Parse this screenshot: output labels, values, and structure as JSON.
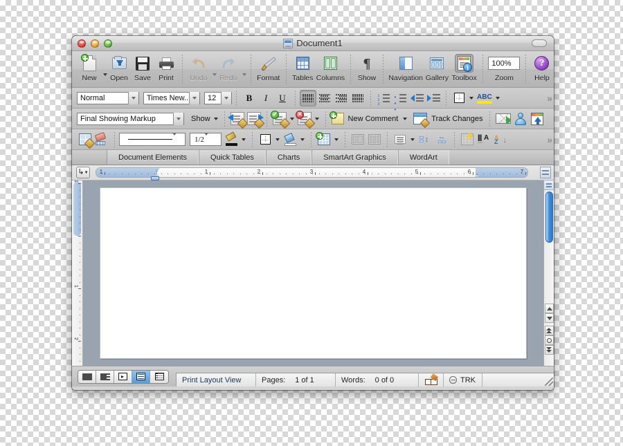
{
  "window": {
    "title": "Document1",
    "title_icon": "docx-file-icon",
    "controls": {
      "close": "close",
      "minimize": "minimize",
      "zoom": "zoom"
    },
    "toolbar_toggle": "toolbar-toggle-button"
  },
  "standard_toolbar": {
    "items": [
      {
        "label": "New",
        "icon": "new-document-icon",
        "dropdown": true,
        "disabled": false,
        "selected": false
      },
      {
        "label": "Open",
        "icon": "open-folder-icon",
        "dropdown": false,
        "disabled": false,
        "selected": false
      },
      {
        "label": "Save",
        "icon": "floppy-disk-icon",
        "dropdown": false,
        "disabled": false,
        "selected": false
      },
      {
        "label": "Print",
        "icon": "printer-icon",
        "dropdown": false,
        "disabled": false,
        "selected": false
      },
      {
        "label": "Undo",
        "icon": "undo-arrow-icon",
        "dropdown": true,
        "disabled": true,
        "selected": false
      },
      {
        "label": "Redo",
        "icon": "redo-arrow-icon",
        "dropdown": true,
        "disabled": true,
        "selected": false
      },
      {
        "label": "Format",
        "icon": "paintbrush-icon",
        "dropdown": false,
        "disabled": false,
        "selected": false
      },
      {
        "label": "Tables",
        "icon": "table-grid-icon",
        "dropdown": false,
        "disabled": false,
        "selected": false
      },
      {
        "label": "Columns",
        "icon": "columns-icon",
        "dropdown": false,
        "disabled": false,
        "selected": false
      },
      {
        "label": "Show",
        "icon": "pilcrow-icon",
        "dropdown": false,
        "disabled": false,
        "selected": false
      },
      {
        "label": "Navigation",
        "icon": "navigation-pane-icon",
        "dropdown": false,
        "disabled": false,
        "selected": false
      },
      {
        "label": "Gallery",
        "icon": "gallery-icon",
        "dropdown": false,
        "disabled": false,
        "selected": false
      },
      {
        "label": "Toolbox",
        "icon": "toolbox-icon",
        "dropdown": false,
        "disabled": false,
        "selected": true
      },
      {
        "label": "Zoom",
        "icon": "zoom-combo",
        "dropdown": true,
        "disabled": false,
        "selected": false
      },
      {
        "label": "Help",
        "icon": "help-question-icon",
        "dropdown": false,
        "disabled": false,
        "selected": false
      }
    ],
    "zoom_value": "100%"
  },
  "formatting_toolbar": {
    "style": {
      "value": "Normal",
      "name": "style-combo"
    },
    "font": {
      "value": "Times New...",
      "name": "font-combo"
    },
    "size": {
      "value": "12",
      "name": "font-size-combo"
    },
    "bold": "B",
    "italic": "I",
    "underline": "U",
    "buttons": [
      {
        "name": "align-left-button",
        "icon": "align-left-icon",
        "active": true
      },
      {
        "name": "align-center-button",
        "icon": "align-center-icon",
        "active": false
      },
      {
        "name": "align-right-button",
        "icon": "align-right-icon",
        "active": false
      },
      {
        "name": "align-justify-button",
        "icon": "align-justify-icon",
        "active": false
      },
      {
        "name": "numbered-list-button",
        "icon": "numbered-list-icon",
        "active": false
      },
      {
        "name": "bulleted-list-button",
        "icon": "bulleted-list-icon",
        "active": false
      },
      {
        "name": "decrease-indent-button",
        "icon": "decrease-indent-icon",
        "active": false
      },
      {
        "name": "increase-indent-button",
        "icon": "increase-indent-icon",
        "active": false
      },
      {
        "name": "borders-button",
        "icon": "borders-icon",
        "active": false
      },
      {
        "name": "highlight-button",
        "icon": "highlight-abc-icon",
        "active": false
      }
    ],
    "overflow": "»"
  },
  "reviewing_toolbar": {
    "display_mode": {
      "value": "Final Showing Markup",
      "name": "markup-display-combo"
    },
    "show_label": "Show",
    "new_comment_label": "New Comment",
    "track_changes_label": "Track Changes",
    "buttons": [
      {
        "name": "previous-change-button",
        "icon": "previous-change-icon"
      },
      {
        "name": "next-change-button",
        "icon": "next-change-icon"
      },
      {
        "name": "accept-change-button",
        "icon": "accept-change-icon"
      },
      {
        "name": "reject-change-button",
        "icon": "reject-change-icon"
      },
      {
        "name": "new-comment-button",
        "icon": "sticky-note-icon"
      },
      {
        "name": "track-changes-button",
        "icon": "track-changes-icon"
      },
      {
        "name": "mail-recipient-button",
        "icon": "send-mail-icon"
      },
      {
        "name": "reviewers-button",
        "icon": "person-icon"
      },
      {
        "name": "share-workbook-button",
        "icon": "share-upload-icon"
      }
    ]
  },
  "tables_toolbar": {
    "line_style": {
      "value": "",
      "name": "line-style-combo"
    },
    "line_weight": {
      "value": "1/2",
      "name": "line-weight-combo"
    },
    "buttons": [
      {
        "name": "draw-table-button",
        "icon": "draw-table-icon"
      },
      {
        "name": "eraser-button",
        "icon": "eraser-icon"
      },
      {
        "name": "border-color-button",
        "icon": "pen-color-icon"
      },
      {
        "name": "borders-button",
        "icon": "borders-icon"
      },
      {
        "name": "shading-color-button",
        "icon": "fill-bucket-icon"
      },
      {
        "name": "insert-table-button",
        "icon": "insert-table-icon"
      },
      {
        "name": "merge-cells-button",
        "icon": "merge-cells-icon"
      },
      {
        "name": "split-cells-button",
        "icon": "split-cells-icon"
      },
      {
        "name": "align-cell-button",
        "icon": "cell-align-icon"
      },
      {
        "name": "distribute-rows-button",
        "icon": "distribute-rows-icon"
      },
      {
        "name": "distribute-cols-button",
        "icon": "distribute-columns-icon"
      },
      {
        "name": "table-autoformat-button",
        "icon": "table-autoformat-icon"
      },
      {
        "name": "text-direction-button",
        "icon": "text-direction-icon"
      },
      {
        "name": "sort-ascending-button",
        "icon": "sort-az-icon"
      }
    ],
    "overflow": "»"
  },
  "elements_gallery": {
    "tabs": [
      {
        "label": "Document Elements",
        "active": false
      },
      {
        "label": "Quick Tables",
        "active": false
      },
      {
        "label": "Charts",
        "active": false
      },
      {
        "label": "SmartArt Graphics",
        "active": false
      },
      {
        "label": "WordArt",
        "active": false
      }
    ]
  },
  "ruler": {
    "tab_stop_button": "tab-stop-selector",
    "horizontal_numbers": [
      "1",
      "1",
      "2",
      "3",
      "4",
      "5",
      "7"
    ],
    "vertical_numbers": [
      "1",
      "1",
      "2"
    ],
    "unit": "inches"
  },
  "document": {
    "page_background": "#ffffff",
    "canvas_color": "#9aa4b0"
  },
  "view_buttons": [
    {
      "name": "draft-view-button",
      "icon": "draft-view-icon",
      "active": false
    },
    {
      "name": "outline-view-button",
      "icon": "outline-view-icon",
      "active": false
    },
    {
      "name": "publishing-view-button",
      "icon": "publishing-layout-icon",
      "active": false
    },
    {
      "name": "print-layout-view-button",
      "icon": "print-layout-icon",
      "active": true
    },
    {
      "name": "notebook-view-button",
      "icon": "notebook-layout-icon",
      "active": false
    }
  ],
  "status_bar": {
    "view_name": "Print Layout View",
    "pages_label": "Pages:",
    "pages_value": "1 of 1",
    "words_label": "Words:",
    "words_value": "0 of 0",
    "spelling_icon": "spelling-book-icon",
    "track_changes_label": "TRK",
    "track_changes_icon": "trk-status-icon"
  },
  "scrollbar": {
    "split_handle": "split-pane-handle",
    "buttons": [
      {
        "name": "scroll-up-button",
        "icon": "triangle-up-icon"
      },
      {
        "name": "scroll-down-button",
        "icon": "triangle-down-icon"
      },
      {
        "name": "previous-page-button",
        "icon": "double-up-icon"
      },
      {
        "name": "select-browse-object",
        "icon": "circle-icon"
      },
      {
        "name": "next-page-button",
        "icon": "double-down-icon"
      }
    ]
  },
  "colors": {
    "accent_blue": "#3f8fe0",
    "status_text": "#17365d",
    "canvas": "#9aa4b0",
    "toolbar_gray": "#c5c5c5"
  }
}
